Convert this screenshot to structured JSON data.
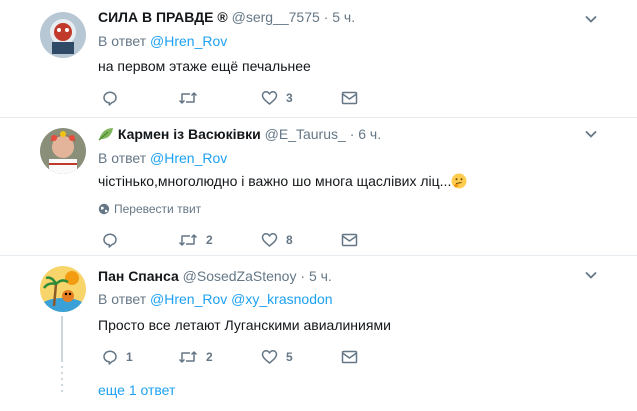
{
  "tweets": [
    {
      "name": "СИЛА В ПРАВДЕ ®",
      "handle": "@serg__7575",
      "dot": "·",
      "time": "5 ч.",
      "reply_prefix": "В ответ",
      "reply_mentions": [
        "@Hren_Rov"
      ],
      "text": "на первом этаже ещё печальнее",
      "reply_count": "",
      "retweet_count": "",
      "like_count": "3"
    },
    {
      "name": "Кармен із Васюківки",
      "handle": "@E_Taurus_",
      "dot": "·",
      "time": "6 ч.",
      "reply_prefix": "В ответ",
      "reply_mentions": [
        "@Hren_Rov"
      ],
      "text": "чістінько,многолюдно і важно шо многа щаслівих ліц...",
      "translate_label": "Перевести твит",
      "reply_count": "",
      "retweet_count": "2",
      "like_count": "8"
    },
    {
      "name": "Пан Спанса",
      "handle": "@SosedZaStenoy",
      "dot": "·",
      "time": "5 ч.",
      "reply_prefix": "В ответ",
      "reply_mentions": [
        "@Hren_Rov",
        "@xy_krasnodon"
      ],
      "text": "Просто все летают Луганскими авиалиниями",
      "reply_count": "1",
      "retweet_count": "2",
      "like_count": "5"
    }
  ],
  "show_more": "еще 1 ответ",
  "colors": {
    "accent": "#1da1f2",
    "muted": "#657786",
    "border": "#e6ecf0",
    "thread": "#ccd6dd",
    "leaf": "#7fb65b"
  },
  "icons": [
    "reply-icon",
    "retweet-icon",
    "like-icon",
    "message-icon",
    "caret-down-icon",
    "globe-icon",
    "leaf-icon",
    "thinking-emoji-icon"
  ]
}
